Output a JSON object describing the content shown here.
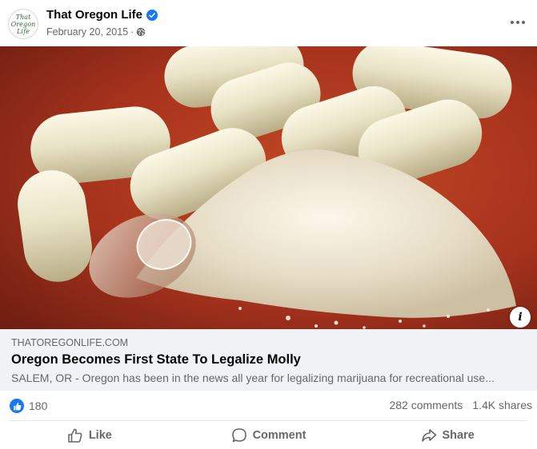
{
  "post": {
    "page_name": "That Oregon Life",
    "avatar_text": "That Oregon Life",
    "date": "February 20, 2015",
    "separator": "·",
    "verified_icon": "verified-badge-icon",
    "audience_icon": "globe-icon"
  },
  "link": {
    "domain": "THATOREGONLIFE.COM",
    "title": "Oregon Becomes First State To Legalize Molly",
    "description": "SALEM, OR - Oregon has been in the news all year for legalizing marijuana for recreational use..."
  },
  "stats": {
    "reactions_count": "180",
    "comments": "282 comments",
    "shares": "1.4K shares"
  },
  "actions": {
    "like": "Like",
    "comment": "Comment",
    "share": "Share"
  },
  "colors": {
    "accent": "#1877f2",
    "secondary_text": "#65676b",
    "link_box_bg": "#f0f2f5"
  }
}
